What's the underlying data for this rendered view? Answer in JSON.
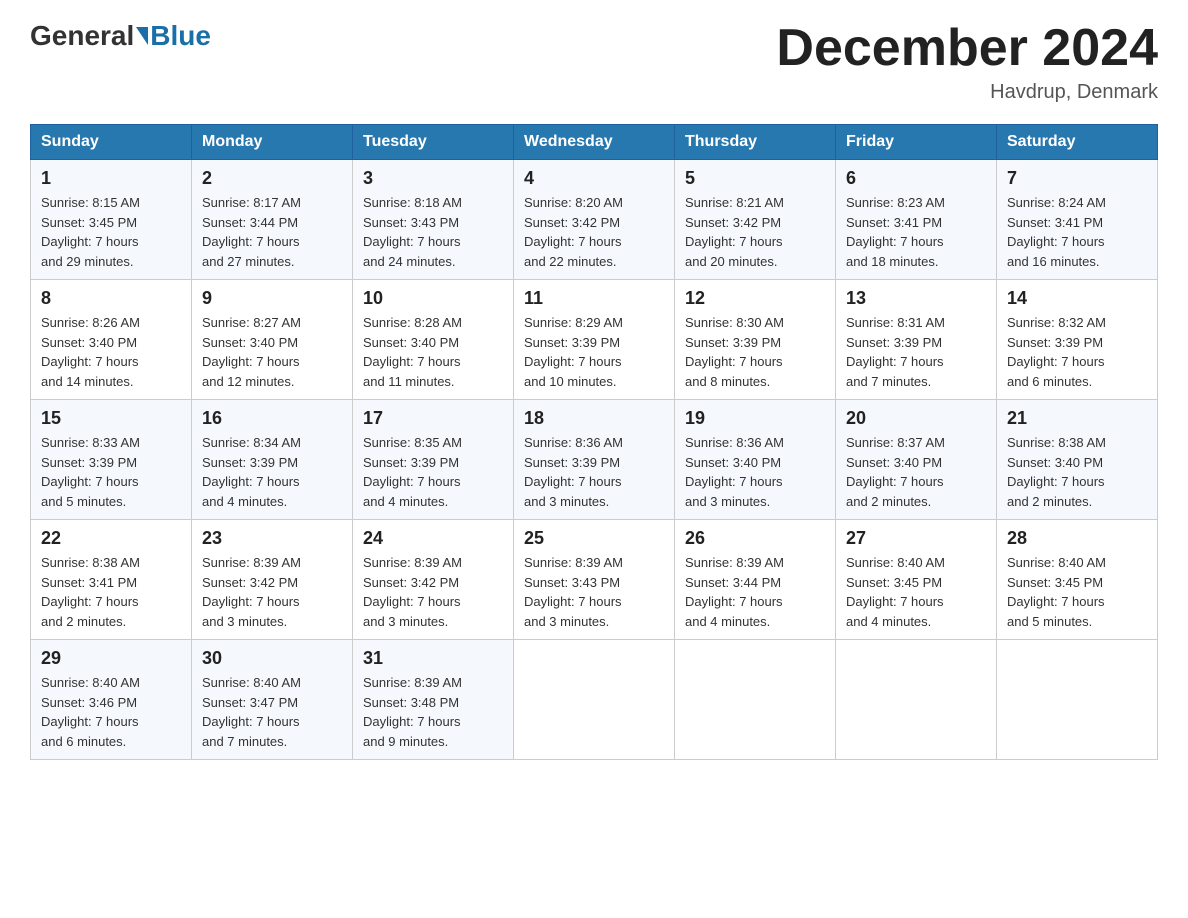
{
  "header": {
    "logo_general": "General",
    "logo_blue": "Blue",
    "month_title": "December 2024",
    "location": "Havdrup, Denmark"
  },
  "weekdays": [
    "Sunday",
    "Monday",
    "Tuesday",
    "Wednesday",
    "Thursday",
    "Friday",
    "Saturday"
  ],
  "weeks": [
    [
      {
        "day": "1",
        "sunrise": "8:15 AM",
        "sunset": "3:45 PM",
        "daylight": "7 hours and 29 minutes."
      },
      {
        "day": "2",
        "sunrise": "8:17 AM",
        "sunset": "3:44 PM",
        "daylight": "7 hours and 27 minutes."
      },
      {
        "day": "3",
        "sunrise": "8:18 AM",
        "sunset": "3:43 PM",
        "daylight": "7 hours and 24 minutes."
      },
      {
        "day": "4",
        "sunrise": "8:20 AM",
        "sunset": "3:42 PM",
        "daylight": "7 hours and 22 minutes."
      },
      {
        "day": "5",
        "sunrise": "8:21 AM",
        "sunset": "3:42 PM",
        "daylight": "7 hours and 20 minutes."
      },
      {
        "day": "6",
        "sunrise": "8:23 AM",
        "sunset": "3:41 PM",
        "daylight": "7 hours and 18 minutes."
      },
      {
        "day": "7",
        "sunrise": "8:24 AM",
        "sunset": "3:41 PM",
        "daylight": "7 hours and 16 minutes."
      }
    ],
    [
      {
        "day": "8",
        "sunrise": "8:26 AM",
        "sunset": "3:40 PM",
        "daylight": "7 hours and 14 minutes."
      },
      {
        "day": "9",
        "sunrise": "8:27 AM",
        "sunset": "3:40 PM",
        "daylight": "7 hours and 12 minutes."
      },
      {
        "day": "10",
        "sunrise": "8:28 AM",
        "sunset": "3:40 PM",
        "daylight": "7 hours and 11 minutes."
      },
      {
        "day": "11",
        "sunrise": "8:29 AM",
        "sunset": "3:39 PM",
        "daylight": "7 hours and 10 minutes."
      },
      {
        "day": "12",
        "sunrise": "8:30 AM",
        "sunset": "3:39 PM",
        "daylight": "7 hours and 8 minutes."
      },
      {
        "day": "13",
        "sunrise": "8:31 AM",
        "sunset": "3:39 PM",
        "daylight": "7 hours and 7 minutes."
      },
      {
        "day": "14",
        "sunrise": "8:32 AM",
        "sunset": "3:39 PM",
        "daylight": "7 hours and 6 minutes."
      }
    ],
    [
      {
        "day": "15",
        "sunrise": "8:33 AM",
        "sunset": "3:39 PM",
        "daylight": "7 hours and 5 minutes."
      },
      {
        "day": "16",
        "sunrise": "8:34 AM",
        "sunset": "3:39 PM",
        "daylight": "7 hours and 4 minutes."
      },
      {
        "day": "17",
        "sunrise": "8:35 AM",
        "sunset": "3:39 PM",
        "daylight": "7 hours and 4 minutes."
      },
      {
        "day": "18",
        "sunrise": "8:36 AM",
        "sunset": "3:39 PM",
        "daylight": "7 hours and 3 minutes."
      },
      {
        "day": "19",
        "sunrise": "8:36 AM",
        "sunset": "3:40 PM",
        "daylight": "7 hours and 3 minutes."
      },
      {
        "day": "20",
        "sunrise": "8:37 AM",
        "sunset": "3:40 PM",
        "daylight": "7 hours and 2 minutes."
      },
      {
        "day": "21",
        "sunrise": "8:38 AM",
        "sunset": "3:40 PM",
        "daylight": "7 hours and 2 minutes."
      }
    ],
    [
      {
        "day": "22",
        "sunrise": "8:38 AM",
        "sunset": "3:41 PM",
        "daylight": "7 hours and 2 minutes."
      },
      {
        "day": "23",
        "sunrise": "8:39 AM",
        "sunset": "3:42 PM",
        "daylight": "7 hours and 3 minutes."
      },
      {
        "day": "24",
        "sunrise": "8:39 AM",
        "sunset": "3:42 PM",
        "daylight": "7 hours and 3 minutes."
      },
      {
        "day": "25",
        "sunrise": "8:39 AM",
        "sunset": "3:43 PM",
        "daylight": "7 hours and 3 minutes."
      },
      {
        "day": "26",
        "sunrise": "8:39 AM",
        "sunset": "3:44 PM",
        "daylight": "7 hours and 4 minutes."
      },
      {
        "day": "27",
        "sunrise": "8:40 AM",
        "sunset": "3:45 PM",
        "daylight": "7 hours and 4 minutes."
      },
      {
        "day": "28",
        "sunrise": "8:40 AM",
        "sunset": "3:45 PM",
        "daylight": "7 hours and 5 minutes."
      }
    ],
    [
      {
        "day": "29",
        "sunrise": "8:40 AM",
        "sunset": "3:46 PM",
        "daylight": "7 hours and 6 minutes."
      },
      {
        "day": "30",
        "sunrise": "8:40 AM",
        "sunset": "3:47 PM",
        "daylight": "7 hours and 7 minutes."
      },
      {
        "day": "31",
        "sunrise": "8:39 AM",
        "sunset": "3:48 PM",
        "daylight": "7 hours and 9 minutes."
      },
      null,
      null,
      null,
      null
    ]
  ],
  "labels": {
    "sunrise": "Sunrise:",
    "sunset": "Sunset:",
    "daylight": "Daylight:"
  }
}
